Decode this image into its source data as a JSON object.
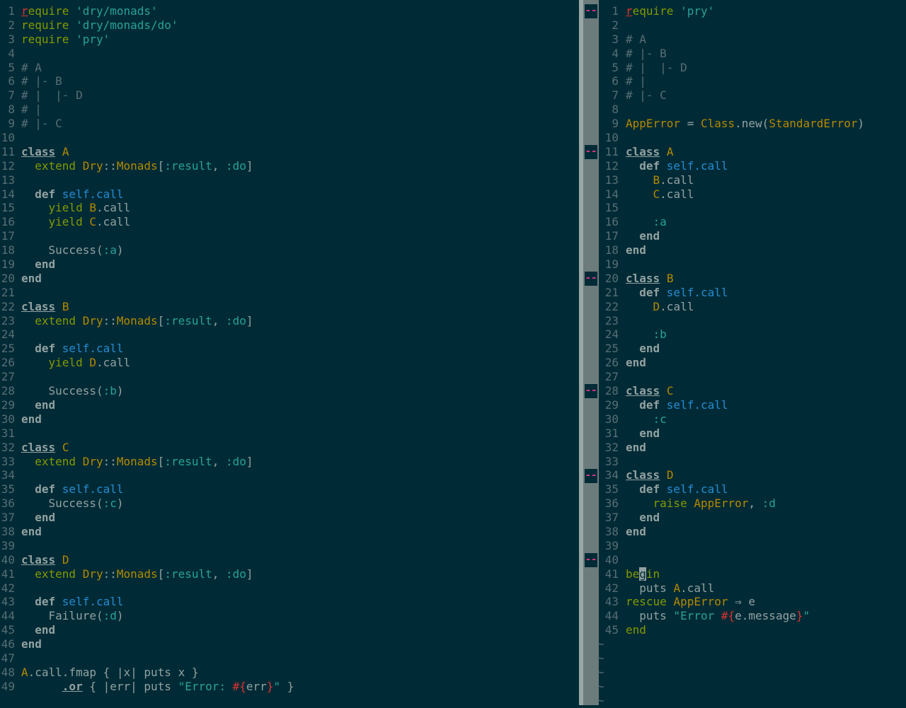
{
  "left": [
    {
      "n": "1",
      "t": [
        [
          "req",
          "r"
        ],
        [
          "green",
          "equire "
        ],
        [
          "str",
          "'dry/monads'"
        ]
      ]
    },
    {
      "n": "2",
      "t": [
        [
          "green",
          "require "
        ],
        [
          "str",
          "'dry/monads/do'"
        ]
      ]
    },
    {
      "n": "3",
      "t": [
        [
          "green",
          "require "
        ],
        [
          "str",
          "'pry'"
        ]
      ]
    },
    {
      "n": "4",
      "t": []
    },
    {
      "n": "5",
      "t": [
        [
          "cmt",
          "# A"
        ]
      ]
    },
    {
      "n": "6",
      "t": [
        [
          "cmt",
          "# |- B"
        ]
      ]
    },
    {
      "n": "7",
      "t": [
        [
          "cmt",
          "# |  |- D"
        ]
      ]
    },
    {
      "n": "8",
      "t": [
        [
          "cmt",
          "# |"
        ]
      ]
    },
    {
      "n": "9",
      "t": [
        [
          "cmt",
          "# |- C"
        ]
      ]
    },
    {
      "n": "10",
      "t": []
    },
    {
      "n": "11",
      "t": [
        [
          "cls",
          "class"
        ],
        [
          "plain",
          " "
        ],
        [
          "const",
          "A"
        ]
      ]
    },
    {
      "n": "12",
      "t": [
        [
          "green",
          "  extend "
        ],
        [
          "const",
          "Dry"
        ],
        [
          "plain",
          "::"
        ],
        [
          "const",
          "Monads"
        ],
        [
          "plain",
          "["
        ],
        [
          "sym",
          ":result"
        ],
        [
          "plain",
          ", "
        ],
        [
          "sym",
          ":do"
        ],
        [
          "plain",
          "]"
        ]
      ]
    },
    {
      "n": "13",
      "t": []
    },
    {
      "n": "14",
      "t": [
        [
          "bold",
          "  def "
        ],
        [
          "blue",
          "self.call"
        ]
      ]
    },
    {
      "n": "15",
      "t": [
        [
          "green",
          "    yield "
        ],
        [
          "const",
          "B"
        ],
        [
          "plain",
          ".call"
        ]
      ]
    },
    {
      "n": "16",
      "t": [
        [
          "green",
          "    yield "
        ],
        [
          "const",
          "C"
        ],
        [
          "plain",
          ".call"
        ]
      ]
    },
    {
      "n": "17",
      "t": []
    },
    {
      "n": "18",
      "t": [
        [
          "plain",
          "    Success("
        ],
        [
          "sym",
          ":a"
        ],
        [
          "plain",
          ")"
        ]
      ]
    },
    {
      "n": "19",
      "t": [
        [
          "bold",
          "  end"
        ]
      ]
    },
    {
      "n": "20",
      "t": [
        [
          "bold",
          "end"
        ]
      ]
    },
    {
      "n": "21",
      "t": []
    },
    {
      "n": "22",
      "t": [
        [
          "cls",
          "class"
        ],
        [
          "plain",
          " "
        ],
        [
          "const",
          "B"
        ]
      ]
    },
    {
      "n": "23",
      "t": [
        [
          "green",
          "  extend "
        ],
        [
          "const",
          "Dry"
        ],
        [
          "plain",
          "::"
        ],
        [
          "const",
          "Monads"
        ],
        [
          "plain",
          "["
        ],
        [
          "sym",
          ":result"
        ],
        [
          "plain",
          ", "
        ],
        [
          "sym",
          ":do"
        ],
        [
          "plain",
          "]"
        ]
      ]
    },
    {
      "n": "24",
      "t": []
    },
    {
      "n": "25",
      "t": [
        [
          "bold",
          "  def "
        ],
        [
          "blue",
          "self.call"
        ]
      ]
    },
    {
      "n": "26",
      "t": [
        [
          "green",
          "    yield "
        ],
        [
          "const",
          "D"
        ],
        [
          "plain",
          ".call"
        ]
      ]
    },
    {
      "n": "27",
      "t": []
    },
    {
      "n": "28",
      "t": [
        [
          "plain",
          "    Success("
        ],
        [
          "sym",
          ":b"
        ],
        [
          "plain",
          ")"
        ]
      ]
    },
    {
      "n": "29",
      "t": [
        [
          "bold",
          "  end"
        ]
      ]
    },
    {
      "n": "30",
      "t": [
        [
          "bold",
          "end"
        ]
      ]
    },
    {
      "n": "31",
      "t": []
    },
    {
      "n": "32",
      "t": [
        [
          "cls",
          "class"
        ],
        [
          "plain",
          " "
        ],
        [
          "const",
          "C"
        ]
      ]
    },
    {
      "n": "33",
      "t": [
        [
          "green",
          "  extend "
        ],
        [
          "const",
          "Dry"
        ],
        [
          "plain",
          "::"
        ],
        [
          "const",
          "Monads"
        ],
        [
          "plain",
          "["
        ],
        [
          "sym",
          ":result"
        ],
        [
          "plain",
          ", "
        ],
        [
          "sym",
          ":do"
        ],
        [
          "plain",
          "]"
        ]
      ]
    },
    {
      "n": "34",
      "t": []
    },
    {
      "n": "35",
      "t": [
        [
          "bold",
          "  def "
        ],
        [
          "blue",
          "self.call"
        ]
      ]
    },
    {
      "n": "36",
      "t": [
        [
          "plain",
          "    Success("
        ],
        [
          "sym",
          ":c"
        ],
        [
          "plain",
          ")"
        ]
      ]
    },
    {
      "n": "37",
      "t": [
        [
          "bold",
          "  end"
        ]
      ]
    },
    {
      "n": "38",
      "t": [
        [
          "bold",
          "end"
        ]
      ]
    },
    {
      "n": "39",
      "t": []
    },
    {
      "n": "40",
      "t": [
        [
          "cls",
          "class"
        ],
        [
          "plain",
          " "
        ],
        [
          "const",
          "D"
        ]
      ]
    },
    {
      "n": "41",
      "t": [
        [
          "green",
          "  extend "
        ],
        [
          "const",
          "Dry"
        ],
        [
          "plain",
          "::"
        ],
        [
          "const",
          "Monads"
        ],
        [
          "plain",
          "["
        ],
        [
          "sym",
          ":result"
        ],
        [
          "plain",
          ", "
        ],
        [
          "sym",
          ":do"
        ],
        [
          "plain",
          "]"
        ]
      ]
    },
    {
      "n": "42",
      "t": []
    },
    {
      "n": "43",
      "t": [
        [
          "bold",
          "  def "
        ],
        [
          "blue",
          "self.call"
        ]
      ]
    },
    {
      "n": "44",
      "t": [
        [
          "plain",
          "    Failure("
        ],
        [
          "sym",
          ":d"
        ],
        [
          "plain",
          ")"
        ]
      ]
    },
    {
      "n": "45",
      "t": [
        [
          "bold",
          "  end"
        ]
      ]
    },
    {
      "n": "46",
      "t": [
        [
          "bold",
          "end"
        ]
      ]
    },
    {
      "n": "47",
      "t": []
    },
    {
      "n": "48",
      "t": [
        [
          "const",
          "A"
        ],
        [
          "plain",
          ".call.fmap { |x| puts x }"
        ]
      ]
    },
    {
      "n": "49",
      "t": [
        [
          "plain",
          "      "
        ],
        [
          "cls",
          ".or"
        ],
        [
          "plain",
          " { |err| puts "
        ],
        [
          "str",
          "\"Error: "
        ],
        [
          "red",
          "#{"
        ],
        [
          "plain",
          "err"
        ],
        [
          "red",
          "}"
        ],
        [
          "str",
          "\""
        ],
        [
          "plain",
          " }"
        ]
      ]
    }
  ],
  "right": [
    {
      "n": "1",
      "t": [
        [
          "req",
          "r"
        ],
        [
          "green",
          "equire "
        ],
        [
          "str",
          "'pry'"
        ]
      ]
    },
    {
      "n": "2",
      "t": []
    },
    {
      "n": "3",
      "t": [
        [
          "cmt",
          "# A"
        ]
      ]
    },
    {
      "n": "4",
      "t": [
        [
          "cmt",
          "# |- B"
        ]
      ]
    },
    {
      "n": "5",
      "t": [
        [
          "cmt",
          "# |  |- D"
        ]
      ]
    },
    {
      "n": "6",
      "t": [
        [
          "cmt",
          "# |"
        ]
      ]
    },
    {
      "n": "7",
      "t": [
        [
          "cmt",
          "# |- C"
        ]
      ]
    },
    {
      "n": "8",
      "t": []
    },
    {
      "n": "9",
      "t": [
        [
          "const",
          "AppError"
        ],
        [
          "plain",
          " = "
        ],
        [
          "const",
          "Class"
        ],
        [
          "plain",
          ".new("
        ],
        [
          "const",
          "StandardError"
        ],
        [
          "plain",
          ")"
        ]
      ]
    },
    {
      "n": "10",
      "t": []
    },
    {
      "n": "11",
      "t": [
        [
          "cls",
          "class"
        ],
        [
          "plain",
          " "
        ],
        [
          "const",
          "A"
        ]
      ]
    },
    {
      "n": "12",
      "t": [
        [
          "bold",
          "  def "
        ],
        [
          "blue",
          "self.call"
        ]
      ]
    },
    {
      "n": "13",
      "t": [
        [
          "const",
          "    B"
        ],
        [
          "plain",
          ".call"
        ]
      ]
    },
    {
      "n": "14",
      "t": [
        [
          "const",
          "    C"
        ],
        [
          "plain",
          ".call"
        ]
      ]
    },
    {
      "n": "15",
      "t": []
    },
    {
      "n": "16",
      "t": [
        [
          "sym",
          "    :a"
        ]
      ]
    },
    {
      "n": "17",
      "t": [
        [
          "bold",
          "  end"
        ]
      ]
    },
    {
      "n": "18",
      "t": [
        [
          "bold",
          "end"
        ]
      ]
    },
    {
      "n": "19",
      "t": []
    },
    {
      "n": "20",
      "t": [
        [
          "cls",
          "class"
        ],
        [
          "plain",
          " "
        ],
        [
          "const",
          "B"
        ]
      ]
    },
    {
      "n": "21",
      "t": [
        [
          "bold",
          "  def "
        ],
        [
          "blue",
          "self.call"
        ]
      ]
    },
    {
      "n": "22",
      "t": [
        [
          "const",
          "    D"
        ],
        [
          "plain",
          ".call"
        ]
      ]
    },
    {
      "n": "23",
      "t": []
    },
    {
      "n": "24",
      "t": [
        [
          "sym",
          "    :b"
        ]
      ]
    },
    {
      "n": "25",
      "t": [
        [
          "bold",
          "  end"
        ]
      ]
    },
    {
      "n": "26",
      "t": [
        [
          "bold",
          "end"
        ]
      ]
    },
    {
      "n": "27",
      "t": []
    },
    {
      "n": "28",
      "t": [
        [
          "cls",
          "class"
        ],
        [
          "plain",
          " "
        ],
        [
          "const",
          "C"
        ]
      ]
    },
    {
      "n": "29",
      "t": [
        [
          "bold",
          "  def "
        ],
        [
          "blue",
          "self.call"
        ]
      ]
    },
    {
      "n": "30",
      "t": [
        [
          "sym",
          "    :c"
        ]
      ]
    },
    {
      "n": "31",
      "t": [
        [
          "bold",
          "  end"
        ]
      ]
    },
    {
      "n": "32",
      "t": [
        [
          "bold",
          "end"
        ]
      ]
    },
    {
      "n": "33",
      "t": []
    },
    {
      "n": "34",
      "t": [
        [
          "cls",
          "class"
        ],
        [
          "plain",
          " "
        ],
        [
          "const",
          "D"
        ]
      ]
    },
    {
      "n": "35",
      "t": [
        [
          "bold",
          "  def "
        ],
        [
          "blue",
          "self.call"
        ]
      ]
    },
    {
      "n": "36",
      "t": [
        [
          "green",
          "    raise "
        ],
        [
          "const",
          "AppError"
        ],
        [
          "plain",
          ", "
        ],
        [
          "sym",
          ":d"
        ]
      ]
    },
    {
      "n": "37",
      "t": [
        [
          "bold",
          "  end"
        ]
      ]
    },
    {
      "n": "38",
      "t": [
        [
          "bold",
          "end"
        ]
      ]
    },
    {
      "n": "39",
      "t": []
    },
    {
      "n": "40",
      "t": []
    },
    {
      "n": "41",
      "t": [
        [
          "green",
          "be"
        ],
        [
          "cursor",
          "g"
        ],
        [
          "green",
          "in"
        ]
      ]
    },
    {
      "n": "42",
      "t": [
        [
          "plain",
          "  puts "
        ],
        [
          "const",
          "A"
        ],
        [
          "plain",
          ".call"
        ]
      ]
    },
    {
      "n": "43",
      "t": [
        [
          "green",
          "rescue "
        ],
        [
          "const",
          "AppError"
        ],
        [
          "plain",
          " ⇒ e"
        ]
      ]
    },
    {
      "n": "44",
      "t": [
        [
          "plain",
          "  puts "
        ],
        [
          "str",
          "\"Error "
        ],
        [
          "red",
          "#{"
        ],
        [
          "plain",
          "e.message"
        ],
        [
          "red",
          "}"
        ],
        [
          "str",
          "\""
        ]
      ]
    },
    {
      "n": "45",
      "t": [
        [
          "green",
          "end"
        ]
      ]
    }
  ],
  "right_tildes": [
    "~",
    "~",
    "~",
    "~",
    "~"
  ],
  "diff_sign": "--",
  "diff_sign_lines": [
    1,
    11,
    20,
    28,
    34,
    40
  ]
}
